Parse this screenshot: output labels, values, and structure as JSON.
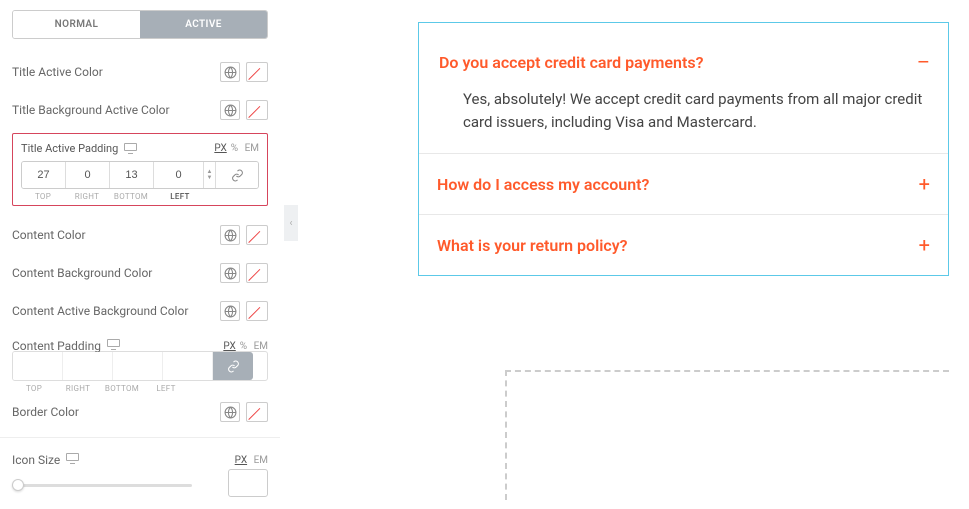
{
  "tabs": {
    "normal": "NORMAL",
    "active": "ACTIVE"
  },
  "fields": {
    "title_active_color": "Title Active Color",
    "title_bg_active_color": "Title Background Active Color",
    "title_active_padding": "Title Active Padding",
    "content_color": "Content Color",
    "content_bg_color": "Content Background Color",
    "content_active_bg_color": "Content Active Background Color",
    "content_padding": "Content Padding",
    "border_color": "Border Color",
    "icon_size": "Icon Size"
  },
  "units": {
    "px": "PX",
    "pct": "%",
    "em": "EM"
  },
  "padding": {
    "top": "27",
    "right": "0",
    "bottom": "13",
    "left": "0",
    "labels": {
      "top": "TOP",
      "right": "RIGHT",
      "bottom": "BOTTOM",
      "left": "LEFT"
    }
  },
  "content_padding": {
    "top": "",
    "right": "",
    "bottom": "",
    "left": ""
  },
  "icon_size_value": "",
  "faq": {
    "items": [
      {
        "q": "Do you accept credit card payments?",
        "a": "Yes, absolutely! We accept credit card payments from all major credit card issuers, including Visa and Mastercard.",
        "open": true,
        "toggle": "–"
      },
      {
        "q": "How do I access my account?",
        "toggle": "+"
      },
      {
        "q": "What is your return policy?",
        "toggle": "+"
      }
    ]
  }
}
